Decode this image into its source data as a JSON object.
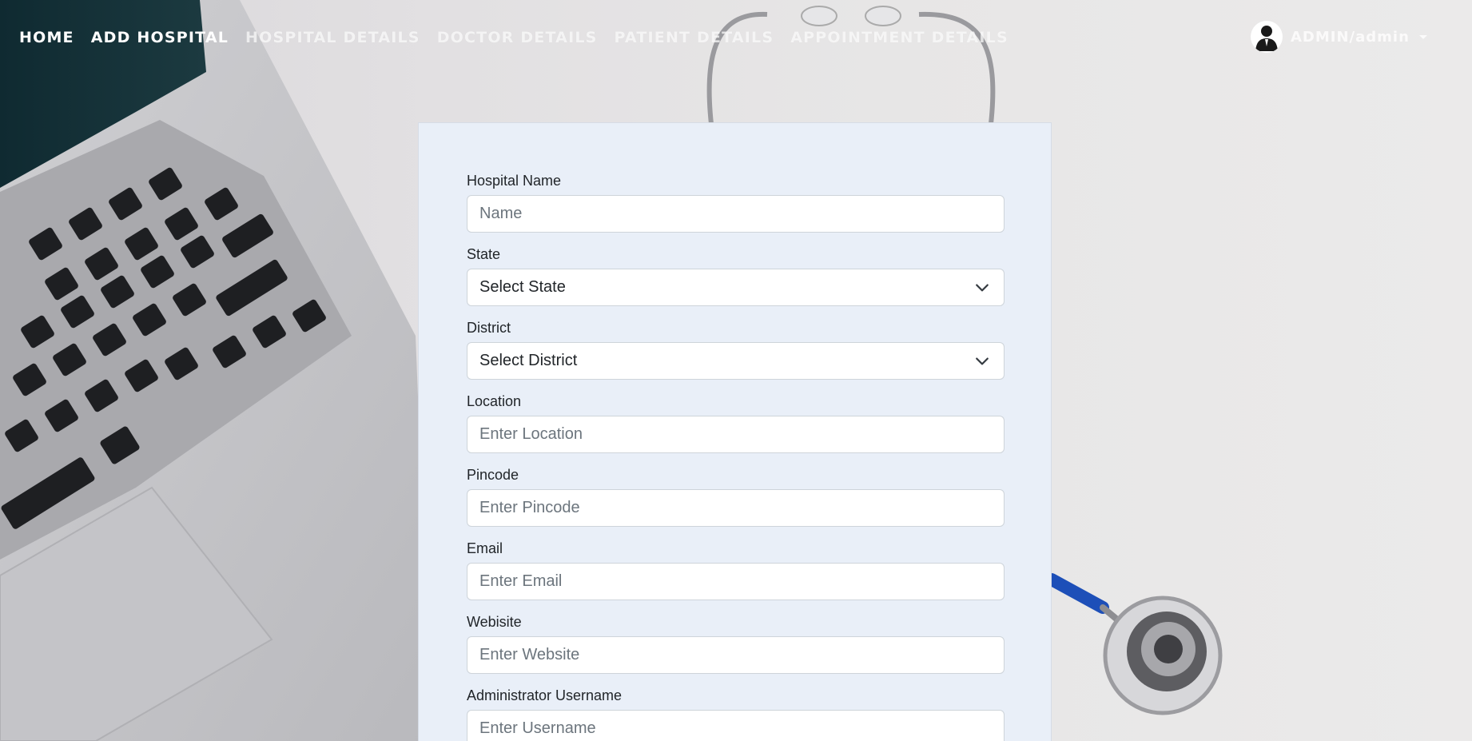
{
  "nav": {
    "items": [
      {
        "label": "HOME"
      },
      {
        "label": "ADD HOSPITAL"
      },
      {
        "label": "HOSPITAL DETAILS"
      },
      {
        "label": "DOCTOR DETAILS"
      },
      {
        "label": "PATIENT DETAILS"
      },
      {
        "label": "APPOINTMENT DETAILS"
      }
    ],
    "user_label": "ADMIN/admin",
    "user_icon": "user-avatar-icon"
  },
  "form": {
    "hospital_name": {
      "label": "Hospital Name",
      "placeholder": "Name"
    },
    "state": {
      "label": "State",
      "selected": "Select State"
    },
    "district": {
      "label": "District",
      "selected": "Select District"
    },
    "location": {
      "label": "Location",
      "placeholder": "Enter Location"
    },
    "pincode": {
      "label": "Pincode",
      "placeholder": "Enter Pincode"
    },
    "email": {
      "label": "Email",
      "placeholder": "Enter Email"
    },
    "website": {
      "label": "Webisite",
      "placeholder": "Enter Website"
    },
    "admin_username": {
      "label": "Administrator Username",
      "placeholder": "Enter Username"
    }
  },
  "colors": {
    "card_background": "#e9eff8",
    "nav_text": "#ffffff",
    "input_border": "#ced4da"
  }
}
